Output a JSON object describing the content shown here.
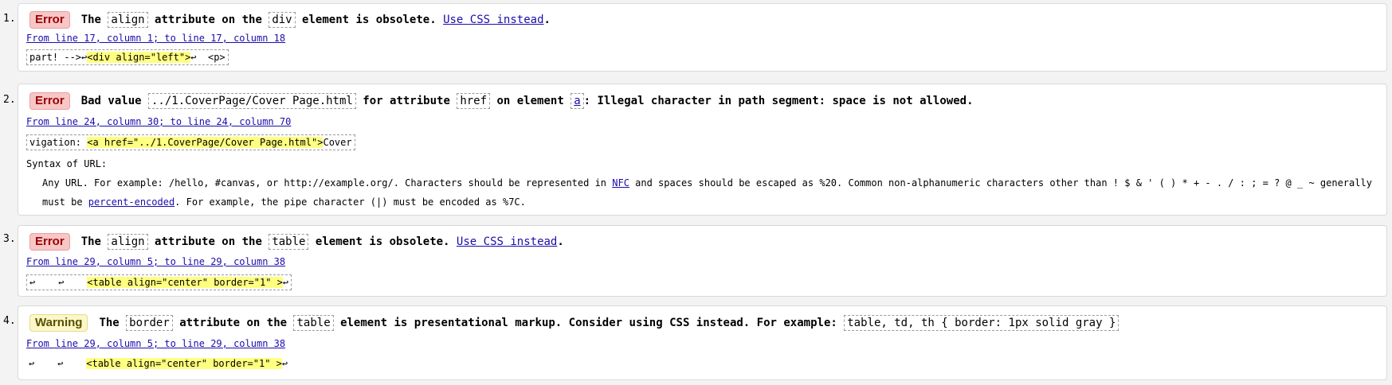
{
  "messages": [
    {
      "number": "1.",
      "type": "Error",
      "text": {
        "p1": "The",
        "code1": "align",
        "p2": "attribute on the",
        "code2": "div",
        "p3": "element is obsolete.",
        "link": "Use CSS instead",
        "p4": "."
      },
      "location": "From line 17, column 1; to line 17, column 18",
      "extract": {
        "before": "part! -->↩",
        "highlight": "<div align=\"left\">",
        "after": "↩  <p>"
      }
    },
    {
      "number": "2.",
      "type": "Error",
      "text": {
        "p1": "Bad value",
        "code1": "../1.CoverPage/Cover Page.html",
        "p2": "for attribute",
        "code2": "href",
        "p3": "on element",
        "code3": "a",
        "p4": ": Illegal character in path segment: space is not allowed."
      },
      "location": "From line 24, column 30; to line 24, column 70",
      "extract": {
        "before": "vigation: ",
        "highlight": "<a href=\"../1.CoverPage/Cover Page.html\">",
        "after": "Cover"
      },
      "syntax": {
        "title": "Syntax of URL:",
        "line1_a": "Any URL. For example: /hello, #canvas, or http://example.org/. Characters should be represented in ",
        "nfc": "NFC",
        "line1_b": " and spaces should be escaped as %20. Common non-alphanumeric characters other than ! $ & ' ( ) * + - . / : ; = ? @ _ ~ generally",
        "line2_a": "must be ",
        "pe": "percent-encoded",
        "line2_b": ". For example, the pipe character (|) must be encoded as %7C."
      }
    },
    {
      "number": "3.",
      "type": "Error",
      "text": {
        "p1": "The",
        "code1": "align",
        "p2": "attribute on the",
        "code2": "table",
        "p3": "element is obsolete.",
        "link": "Use CSS instead",
        "p4": "."
      },
      "location": "From line 29, column 5; to line 29, column 38",
      "extract": {
        "before": "↩    ↩    ",
        "highlight": "<table align=\"center\" border=\"1\" >",
        "after": "↩"
      }
    },
    {
      "number": "4.",
      "type": "Warning",
      "text": {
        "p1": "The",
        "code1": "border",
        "p2": "attribute on the",
        "code2": "table",
        "p3": "element is presentational markup. Consider using CSS instead. For example:",
        "code3": "table, td, th { border: 1px solid gray }"
      },
      "location": "From line 29, column 5; to line 29, column 38",
      "extract": {
        "before": "↩    ↩    ",
        "highlight": "<table align=\"center\" border=\"1\" >",
        "after": "↩"
      }
    }
  ]
}
